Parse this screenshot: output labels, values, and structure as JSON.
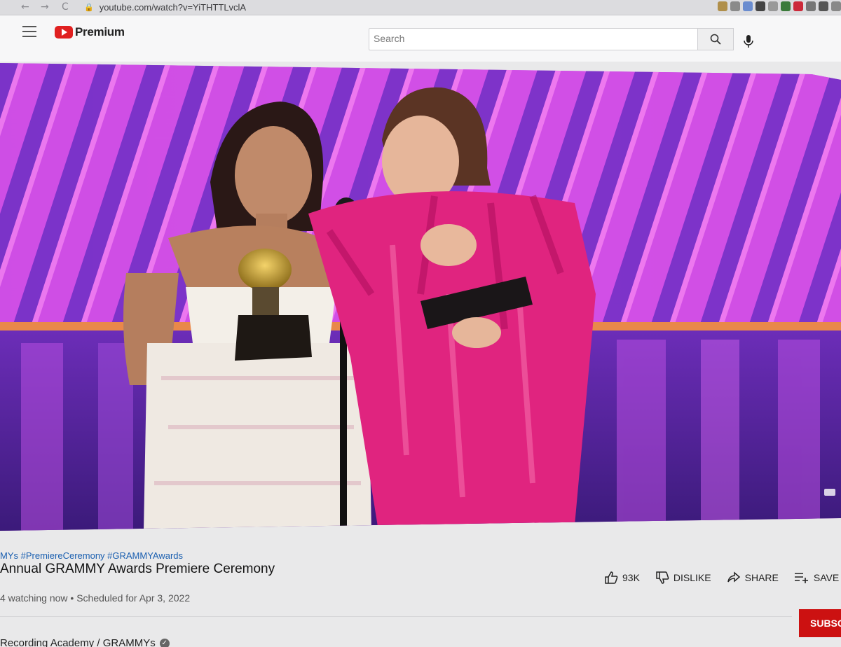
{
  "browser": {
    "url": "youtube.com/watch?v=YiTHTTLvclA",
    "back": "←",
    "forward": "→",
    "reload": "C"
  },
  "header": {
    "logo_text": "Premium",
    "search_placeholder": "Search"
  },
  "video": {
    "tags": "MYs #PremiereCeremony #GRAMMYAwards",
    "title": "Annual GRAMMY Awards Premiere Ceremony",
    "watching": "4 watching now",
    "scheduled": "Scheduled for Apr 3, 2022"
  },
  "actions": {
    "likes": "93K",
    "dislike": "DISLIKE",
    "share": "SHARE",
    "save": "SAVE"
  },
  "channel": {
    "name": "Recording Academy / GRAMMYs",
    "subscribe": "SUBSC"
  },
  "colors": {
    "accent": "#cc1111",
    "stage_magenta": "#d94fe0",
    "stage_purple": "#5a2ca8",
    "dress_pink": "#e0247f"
  }
}
